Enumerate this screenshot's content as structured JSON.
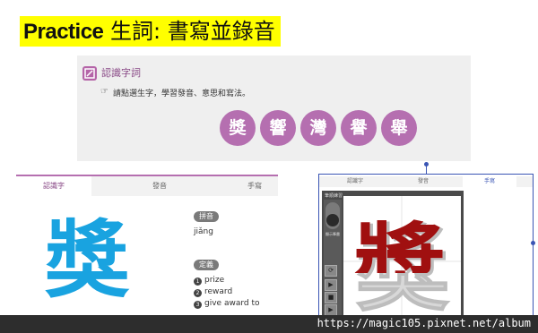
{
  "title": {
    "latin": "Practice",
    "rest": " 生詞: 書寫並錄音"
  },
  "top_panel": {
    "label": "認識字詞",
    "instruction": "請點選生字，學習發音、意思和寫法。",
    "chars": [
      "獎",
      "響",
      "灣",
      "譽",
      "舉"
    ],
    "accent": "#b56fb0"
  },
  "left_panel": {
    "tabs": [
      "認識字",
      "發音",
      "手寫"
    ],
    "character": "獎",
    "pronunciation_label": "拼音",
    "pinyin": "jiǎng",
    "definition_label": "定義",
    "definitions": [
      {
        "num": "1",
        "text": "prize"
      },
      {
        "num": "2",
        "text": "reward"
      },
      {
        "num": "3",
        "text": "give award to"
      }
    ],
    "char_color": "#19a3e0"
  },
  "right_panel": {
    "tabs": [
      "認識字",
      "發音",
      "手寫"
    ],
    "frame_label": "筆順練習",
    "side_label": "顯示筆畫",
    "character": "獎",
    "stroke_color": "#a01010",
    "controls": [
      "⟳",
      "▶",
      "■",
      "▶"
    ]
  },
  "watermark": {
    "url": "https://magic105.pixnet.net/album"
  }
}
